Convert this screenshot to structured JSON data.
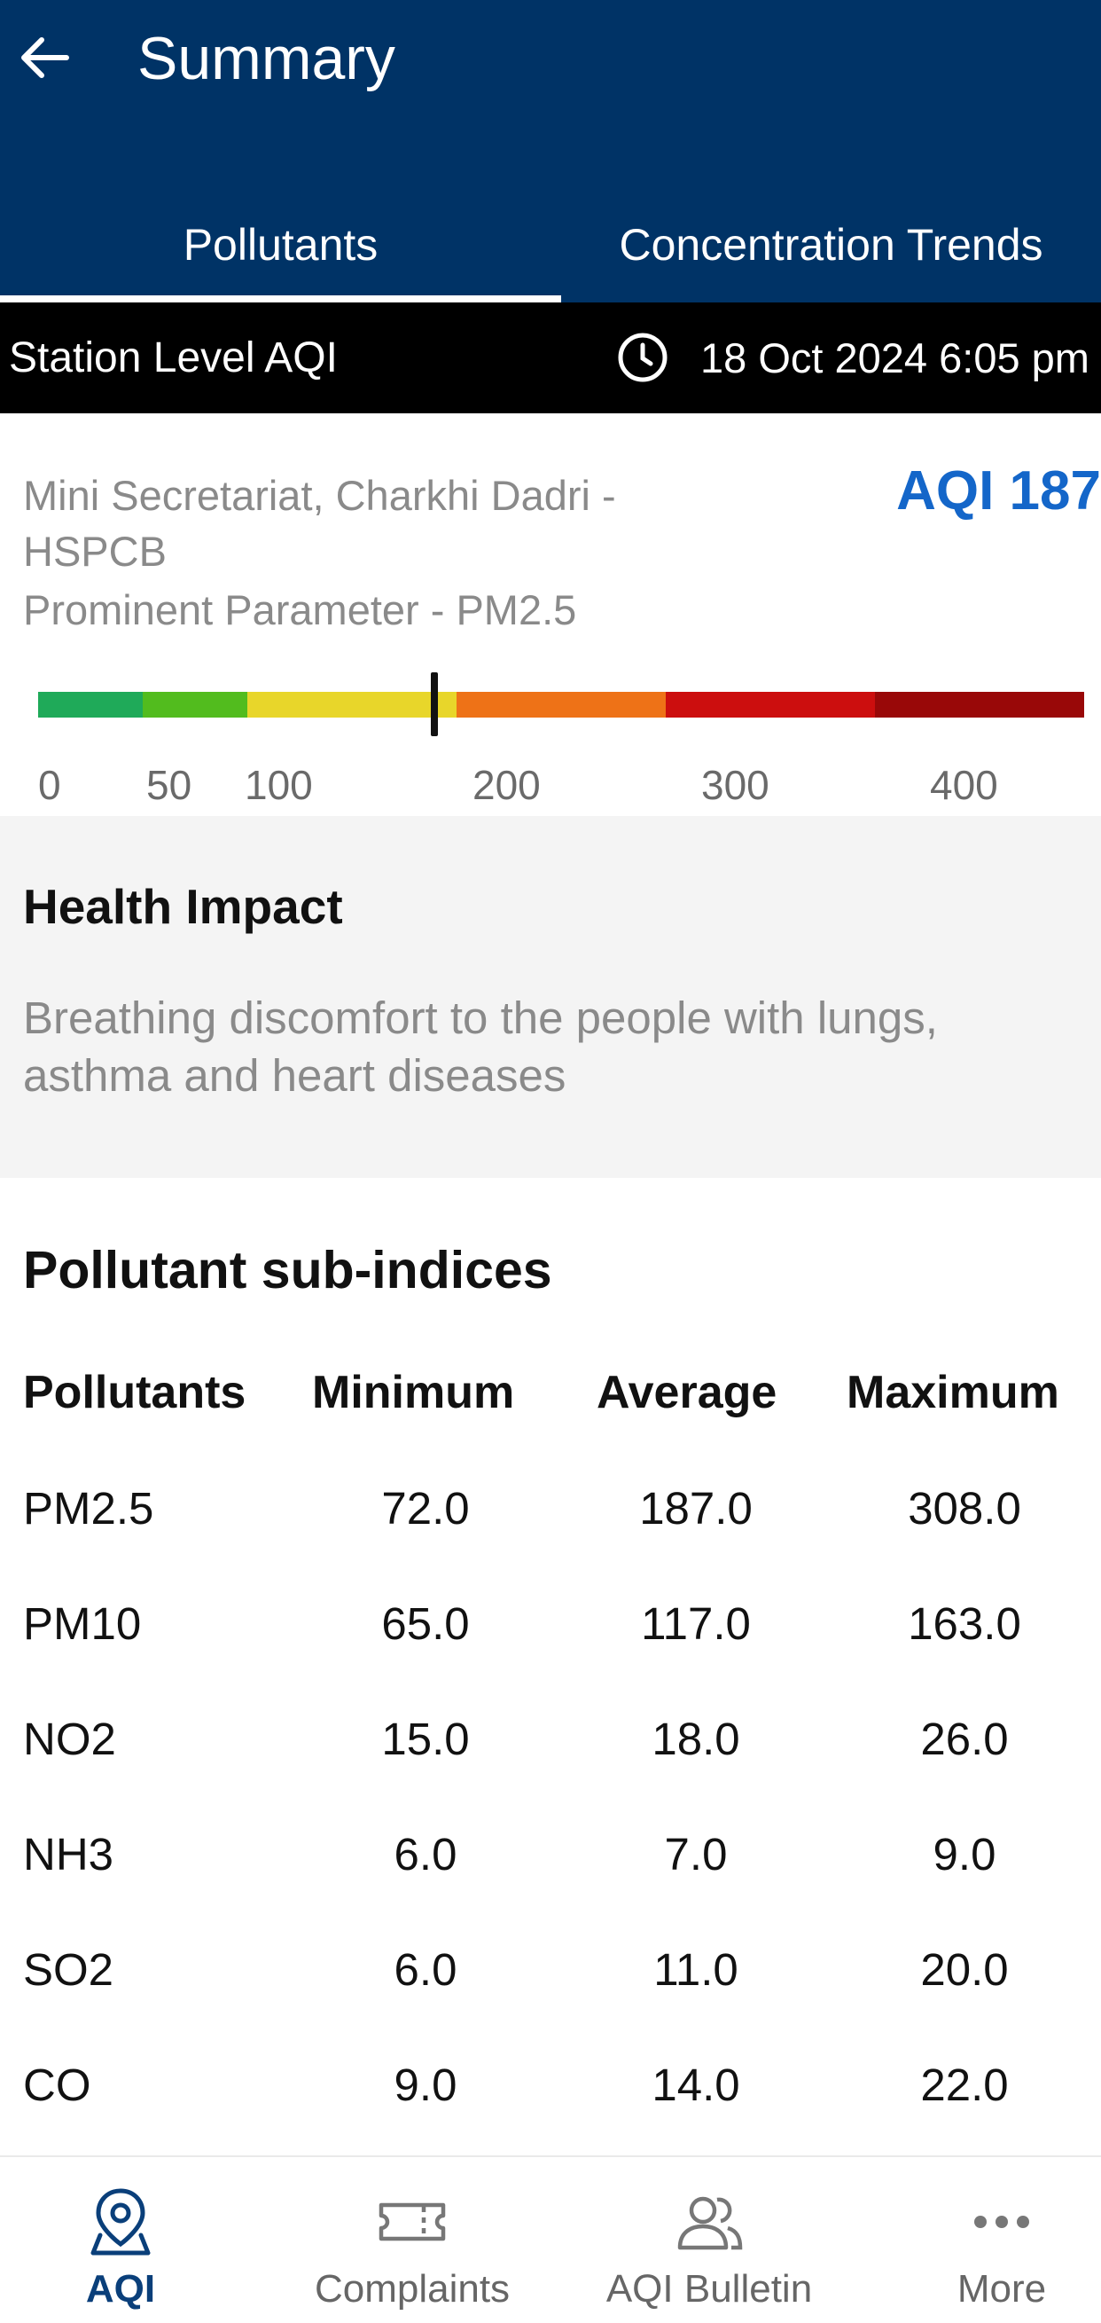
{
  "header": {
    "title": "Summary",
    "tabs": [
      {
        "label": "Pollutants",
        "active": true
      },
      {
        "label": "Concentration Trends",
        "active": false
      }
    ]
  },
  "station": {
    "label": "Station Level AQI",
    "datetime": "18 Oct 2024 6:05 pm",
    "name": "Mini Secretariat, Charkhi Dadri - HSPCB",
    "aqi_label": "AQI 187",
    "aqi": 187,
    "prominent": "Prominent Parameter - PM2.5"
  },
  "scale": {
    "ticks": [
      "0",
      "50",
      "100",
      "200",
      "300",
      "400"
    ],
    "colors": [
      "#1faa59",
      "#52bc1e",
      "#e8d62a",
      "#ee7217",
      "#cc0e0e",
      "#990808"
    ]
  },
  "health": {
    "title": "Health Impact",
    "text": "Breathing discomfort to the people with lungs, asthma and heart diseases"
  },
  "subindices": {
    "title": "Pollutant sub-indices",
    "columns": [
      "Pollutants",
      "Minimum",
      "Average",
      "Maximum"
    ],
    "rows": [
      [
        "PM2.5",
        "72.0",
        "187.0",
        "308.0"
      ],
      [
        "PM10",
        "65.0",
        "117.0",
        "163.0"
      ],
      [
        "NO2",
        "15.0",
        "18.0",
        "26.0"
      ],
      [
        "NH3",
        "6.0",
        "7.0",
        "9.0"
      ],
      [
        "SO2",
        "6.0",
        "11.0",
        "20.0"
      ],
      [
        "CO",
        "9.0",
        "14.0",
        "22.0"
      ]
    ]
  },
  "nav": {
    "items": [
      {
        "label": "AQI",
        "icon": "location-pin-icon",
        "active": true
      },
      {
        "label": "Complaints",
        "icon": "ticket-icon",
        "active": false
      },
      {
        "label": "AQI Bulletin",
        "icon": "users-icon",
        "active": false
      },
      {
        "label": "More",
        "icon": "more-dots-icon",
        "active": false
      }
    ]
  },
  "colors": {
    "header_bg": "#003366",
    "aqi_accent": "#1466c9",
    "active_nav": "#0a3f7a"
  }
}
